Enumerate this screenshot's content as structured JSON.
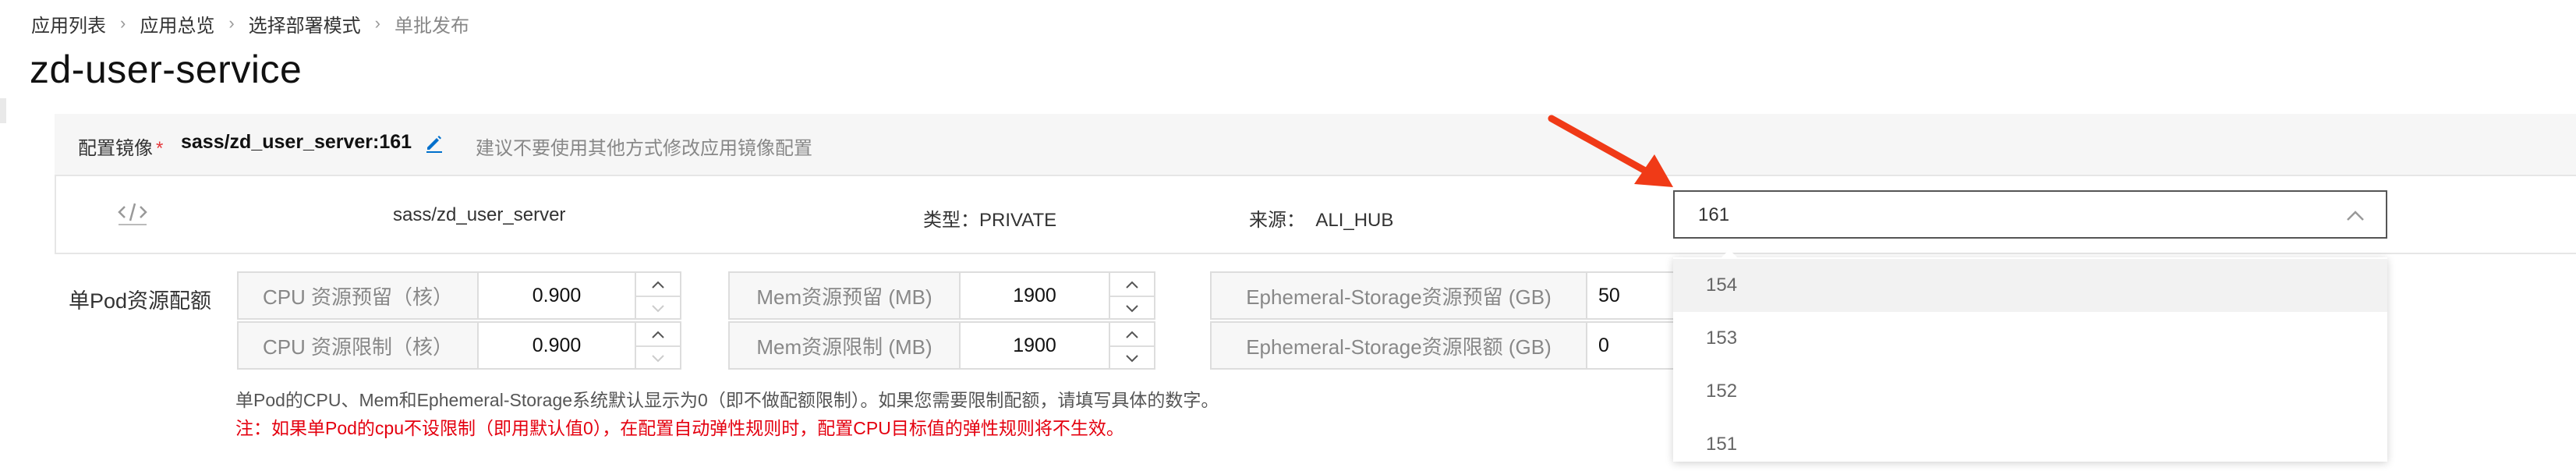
{
  "breadcrumb": {
    "items": [
      "应用列表",
      "应用总览",
      "选择部署模式"
    ],
    "current": "单批发布",
    "separator": "›"
  },
  "page_title": "zd-user-service",
  "image_config": {
    "label": "配置镜像",
    "required_mark": "*",
    "image": "sass/zd_user_server:161",
    "edit_icon": "pencil-icon",
    "hint": "建议不要使用其他方式修改应用镜像配置"
  },
  "image_row": {
    "code_icon": "code-icon",
    "repository": "sass/zd_user_server",
    "type_text": "类型：PRIVATE",
    "source_text": "来源：  ALI_HUB",
    "version_select": {
      "value": "161",
      "chevron_icon": "chevron-up-icon",
      "options": [
        "154",
        "153",
        "152",
        "151"
      ],
      "hovered_option": "154"
    }
  },
  "pod_quota": {
    "label": "单Pod资源配额",
    "rows": [
      [
        {
          "label": "CPU 资源预留（核）",
          "value": "0.900"
        },
        {
          "label": "Mem资源预留 (MB)",
          "value": "1900"
        },
        {
          "label": "Ephemeral-Storage资源预留 (GB)",
          "value": "50"
        }
      ],
      [
        {
          "label": "CPU 资源限制（核）",
          "value": "0.900"
        },
        {
          "label": "Mem资源限制 (MB)",
          "value": "1900"
        },
        {
          "label": "Ephemeral-Storage资源限额 (GB)",
          "value": "0"
        }
      ]
    ],
    "note": "单Pod的CPU、Mem和Ephemeral-Storage系统默认显示为0（即不做配额限制）。如果您需要限制配额，请填写具体的数字。",
    "warning": "注：如果单Pod的cpu不设限制（即用默认值0），在配置自动弹性规则时，配置CPU目标值的弹性规则将不生效。"
  },
  "colors": {
    "accent_blue": "#0070cc",
    "warning_red": "#e4000f",
    "required_red": "#e4393c",
    "annotation_arrow": "#f03a17"
  }
}
